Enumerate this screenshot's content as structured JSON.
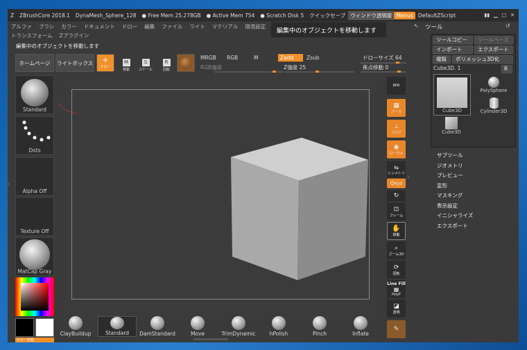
{
  "titlebar": {
    "app": "ZBrushCore 2018.1",
    "doc": "DynaMesh_Sphere_128",
    "free_mem": "● Free Mem 25.278GB",
    "active_mem": "● Active Mem 754",
    "scratch": "● Scratch Disk 5",
    "quicksave": "クイックセーブ",
    "transparency": "ウィンドウ透明度",
    "menus": "Menus",
    "zscript": "DefaultZScript"
  },
  "menu": [
    "アルファ",
    "ブラシ",
    "カラー",
    "ドキュメント",
    "ドロー",
    "編集",
    "ファイル",
    "ライト",
    "マテリアル",
    "環境設定"
  ],
  "menu2": [
    "トランスフォーム",
    "Zプラグイン"
  ],
  "tooltip": "編集中のオブジェクトを移動します",
  "status": "編集中のオブジェクトを移動します",
  "toolbar": {
    "home": "ホームページ",
    "lightbox": "ライトボックス",
    "edit": "ドロー",
    "move": "移動",
    "scale": "スケール",
    "rotate": "回転",
    "mrgb": "MRGB",
    "rgb": "RGB",
    "m": "M",
    "zadd": "Zadd",
    "zsub": "Zsub",
    "rgb_intensity": "RGB強度",
    "z_intensity_label": "Z強度",
    "z_intensity_value": "25",
    "draw_size_label": "ドローサイズ",
    "draw_size_value": "64",
    "focal_shift_label": "焦点移動",
    "focal_shift_value": "0"
  },
  "left": {
    "brush": "Standard",
    "stroke": "Dots",
    "alpha": "Alpha Off",
    "texture": "Texture Off",
    "material": "MatCap Gray",
    "switch_color": "カラー切替"
  },
  "strip": {
    "bpr": "BPR",
    "persp": "パース",
    "floor": "フロア",
    "local": "ローカル",
    "symmetry": "シンメトリ",
    "xyz": "Qxyz",
    "frame": "フレーム",
    "move": "移動",
    "zoom": "ズーム3D",
    "rotate": "回転",
    "linefill": "Line Fill",
    "polyf": "PolyF",
    "transp": "透明"
  },
  "tool": {
    "title": "ツール",
    "load": "ツールコピー",
    "save": "ツールペースト",
    "import": "インポート",
    "export": "エクスポート",
    "clone": "複製",
    "polymesh": "ポリメッシュ3D化",
    "current": "Cube3D. 1",
    "r": "R",
    "thumbs": [
      "Cube3D",
      "PolySphere",
      "Cylinder3D",
      "Cube3D"
    ],
    "sections": [
      "サブツール",
      "ジオメトリ",
      "プレビュー",
      "変形",
      "マスキング",
      "表示設定",
      "イニシャライズ",
      "エクスポート"
    ]
  },
  "brushes": [
    "ClayBuildup",
    "Standard",
    "DamStandard",
    "Move",
    "TrimDynamic",
    "hPolish",
    "Pinch",
    "Inflate"
  ]
}
